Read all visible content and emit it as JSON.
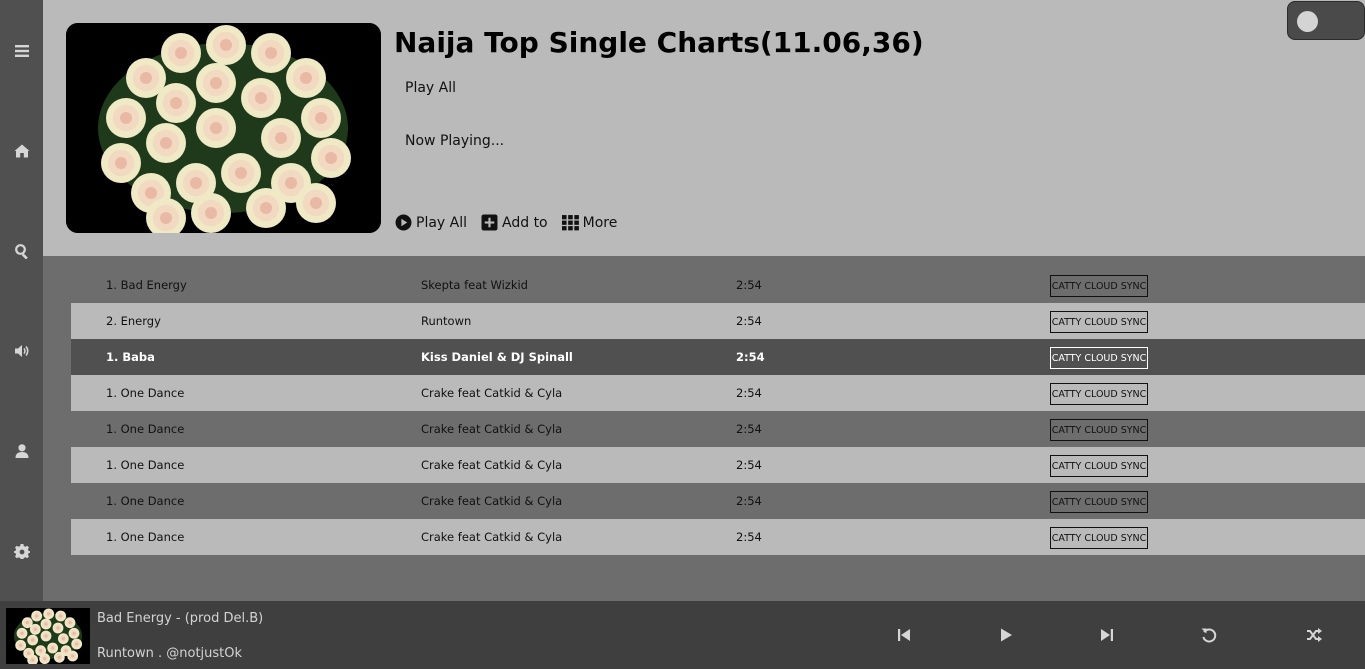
{
  "sidebar": {
    "icons": [
      "menu-icon",
      "home-icon",
      "search-icon",
      "volume-icon",
      "user-icon",
      "gear-icon"
    ]
  },
  "header": {
    "title": "Naija Top Single Charts(11.06,36)",
    "play_all_label": "Play All",
    "now_playing_label": "Now Playing...",
    "actions": {
      "play_all": "Play All",
      "add_to": "Add to",
      "more": "More"
    },
    "toggle_on": false
  },
  "tracks": [
    {
      "title": "1. Bad Energy",
      "artist": "Skepta feat Wizkid",
      "time": "2:54",
      "action": "CATTY CLOUD SYNC"
    },
    {
      "title": "2. Energy",
      "artist": "Runtown",
      "time": "2:54",
      "action": "CATTY CLOUD SYNC"
    },
    {
      "title": "1. Baba",
      "artist": "Kiss Daniel & DJ Spinall",
      "time": "2:54",
      "action": "CATTY CLOUD SYNC"
    },
    {
      "title": "1. One Dance",
      "artist": "Crake feat Catkid & Cyla",
      "time": "2:54",
      "action": "CATTY CLOUD SYNC"
    },
    {
      "title": "1. One Dance",
      "artist": "Crake feat Catkid & Cyla",
      "time": "2:54",
      "action": "CATTY CLOUD SYNC"
    },
    {
      "title": "1. One Dance",
      "artist": "Crake feat Catkid & Cyla",
      "time": "2:54",
      "action": "CATTY CLOUD SYNC"
    },
    {
      "title": "1. One Dance",
      "artist": "Crake feat Catkid & Cyla",
      "time": "2:54",
      "action": "CATTY CLOUD SYNC"
    },
    {
      "title": "1. One Dance",
      "artist": "Crake feat Catkid & Cyla",
      "time": "2:54",
      "action": "CATTY CLOUD SYNC"
    }
  ],
  "player": {
    "now_playing_title": "Bad Energy - (prod Del.B)",
    "now_playing_artist": "Runtown . @notjustOk",
    "controls": [
      "previous-icon",
      "play-icon",
      "next-icon",
      "repeat-icon",
      "shuffle-icon"
    ]
  },
  "colors": {
    "sidebar_bg": "#505050",
    "header_bg": "#bababa",
    "row_dark": "#6d6d6d",
    "row_light": "#bababa",
    "row_active": "#505050",
    "player_bg": "#3f3f3f"
  }
}
